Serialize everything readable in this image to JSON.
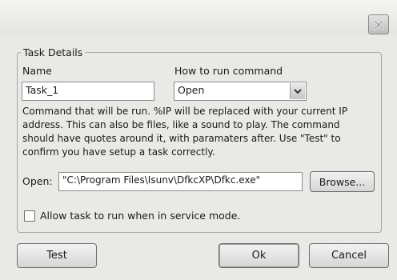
{
  "window": {
    "close_icon": "close-icon"
  },
  "task_details": {
    "legend": "Task Details",
    "name_label": "Name",
    "name_value": "Task_1",
    "how_label": "How to run command",
    "how_value": "Open",
    "description": "Command that will be run.  %IP will be replaced with your current IP address.  This can also be files, like a sound to play.  The command should have quotes around it, with paramaters after.  Use \"Test\" to confirm you have setup a task correctly.",
    "open_label": "Open:",
    "open_value": "\"C:\\Program Files\\Isunv\\DfkcXP\\Dfkc.exe\"",
    "browse_label": "Browse...",
    "service_mode_label": "Allow task to run when in service mode.",
    "service_mode_checked": false
  },
  "buttons": {
    "test": "Test",
    "ok": "Ok",
    "cancel": "Cancel"
  }
}
